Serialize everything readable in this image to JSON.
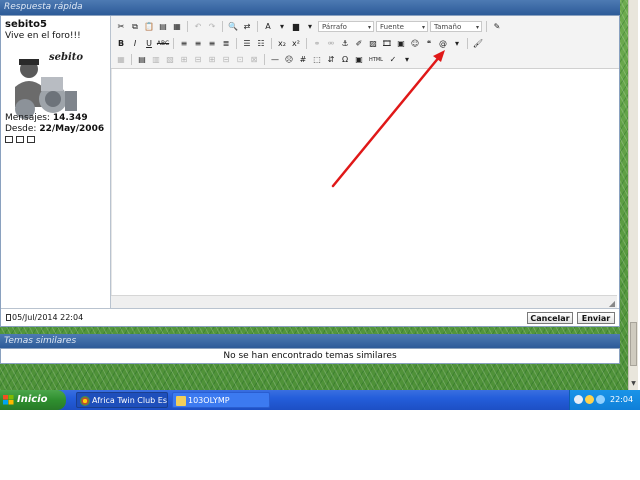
{
  "header": {
    "title": "Respuesta rápida"
  },
  "user": {
    "name": "sebito5",
    "status": "Vive en el foro!!!",
    "avatar_text": "sebito",
    "posts_label": "Mensajes:",
    "posts_value": "14.349",
    "joined_label": "Desde:",
    "joined_value": "22/May/2006"
  },
  "toolbar": {
    "paragraph_select": "Párrafo",
    "font_select": "Fuente",
    "size_select": "Tamaño",
    "bold": "B",
    "italic": "I",
    "underline": "U",
    "strikethrough": "ABC",
    "subscript": "x₂",
    "superscript": "x²",
    "symbol": "Ω",
    "hash": "#",
    "font_color": "A",
    "html": "HTML",
    "at": "@"
  },
  "footer": {
    "post_date": "05/Jul/2014 22:04",
    "cancel_label": "Cancelar",
    "send_label": "Enviar"
  },
  "similar": {
    "header": "Temas similares",
    "empty_message": "No se han encontrado temas similares"
  },
  "taskbar": {
    "start_label": "Inicio",
    "tasks": [
      {
        "label": "Africa Twin Club Espa..."
      },
      {
        "label": "103OLYMP"
      }
    ],
    "clock": "22:04"
  },
  "colors": {
    "header_blue": "#2d5b98",
    "grass_green": "#5a9a43",
    "arrow_red": "#e01818",
    "taskbar_blue": "#245edb",
    "start_green": "#2f8f2f"
  }
}
